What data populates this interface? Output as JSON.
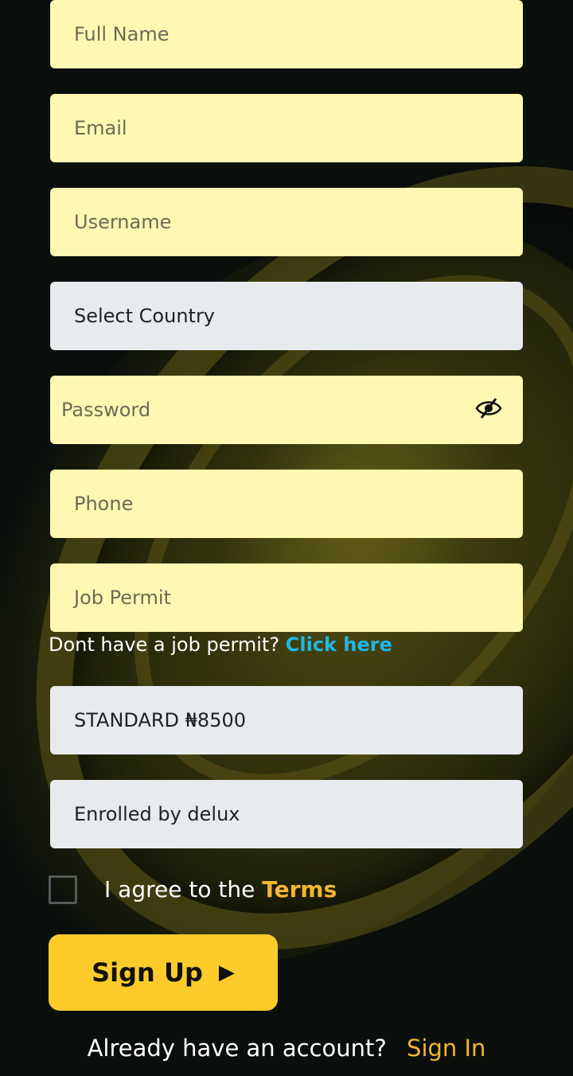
{
  "form": {
    "full_name_placeholder": "Full Name",
    "email_placeholder": "Email",
    "username_placeholder": "Username",
    "country_selected": "Select Country",
    "password_placeholder": "Password",
    "phone_placeholder": "Phone",
    "job_permit_placeholder": "Job Permit",
    "plan_selected": "STANDARD ₦8500",
    "enrolled_by": "Enrolled by delux"
  },
  "job_permit_note": {
    "text": "Dont have a job permit?",
    "link": "Click here"
  },
  "agree": {
    "text": "I agree to the",
    "terms": "Terms",
    "checked": false
  },
  "signup_button": {
    "label": "Sign Up",
    "icon": "play-icon"
  },
  "footer": {
    "text": "Already have an account?",
    "signin": "Sign In"
  },
  "colors": {
    "accent": "#fdcc2a",
    "link": "#1eb8e8",
    "field_yellow": "#fff8b3",
    "field_grey": "#e8ebee"
  }
}
